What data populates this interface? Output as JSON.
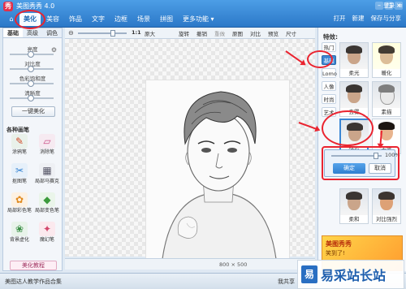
{
  "app": {
    "title": "美图秀秀 4.0",
    "logo": "秀"
  },
  "nav": {
    "home_icon": "⌂",
    "tabs": [
      "美化",
      "美容",
      "饰品",
      "文字",
      "边框",
      "场景",
      "拼图",
      "更多功能 ▾"
    ],
    "active": "美化"
  },
  "top_right": {
    "login": "登录",
    "menu": "≡",
    "actions": [
      "打开",
      "新建",
      "保存与分享"
    ]
  },
  "left_panel": {
    "subtabs": [
      "基础",
      "高级",
      "调色"
    ],
    "sliders": [
      "亮度",
      "对比度",
      "色彩饱和度",
      "清晰度"
    ],
    "one_key": "一键美化",
    "section": "各种画笔",
    "tools": [
      "涂鸦笔",
      "消除笔",
      "抠图笔",
      "局部马赛克",
      "局部彩色笔",
      "局部变色笔",
      "背景虚化",
      "魔幻笔"
    ],
    "tutorial": "美化教程"
  },
  "canvas_toolbar": {
    "ratio": "1:1",
    "actual": "原大",
    "buttons": [
      "旋转",
      "撤销",
      "重做",
      "原图",
      "对比",
      "预览",
      "尺寸"
    ]
  },
  "canvas": {
    "dims": "800 × 500"
  },
  "right_panel": {
    "title": "特效:",
    "categories": [
      "热门",
      "基础",
      "Lomo",
      "人像",
      "时尚",
      "艺术"
    ],
    "active_category": "基础",
    "thumbs": [
      "柔光",
      "暖化",
      "去雾",
      "素描",
      "锐化",
      "去雾",
      "柔和",
      "对比强烈"
    ],
    "popup": {
      "value": "100%",
      "ok": "确定",
      "cancel": "取消"
    },
    "ad": {
      "line1": "美图秀秀",
      "line2": "笑到了!"
    }
  },
  "bottom": {
    "news": "美图达人教学作品合集",
    "share": "我共享",
    "watermark": "易采站长站"
  },
  "colors": {
    "nav": "#2c78c8",
    "accent": "#3a86d4",
    "annotation": "#ea2430"
  }
}
